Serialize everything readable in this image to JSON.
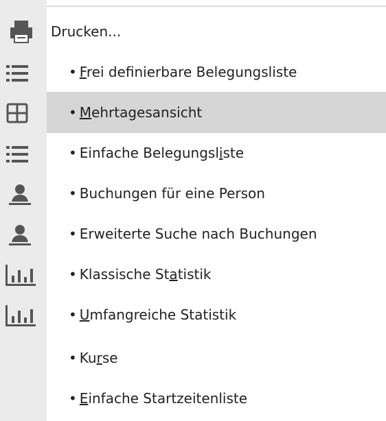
{
  "menu": {
    "items": [
      {
        "icon": "printer-icon",
        "prefix": "",
        "pre": "",
        "ul": "",
        "post": "Drucken...",
        "sub": false,
        "highlight": false
      },
      {
        "icon": "list-icon",
        "prefix": "•",
        "pre": "",
        "ul": "F",
        "post": "rei definierbare Belegungsliste",
        "sub": true,
        "highlight": false
      },
      {
        "icon": "grid-icon",
        "prefix": "•",
        "pre": "",
        "ul": "M",
        "post": "ehrtagesansicht",
        "sub": true,
        "highlight": true
      },
      {
        "icon": "list-icon",
        "prefix": "•",
        "pre": "Einfache Belegungsl",
        "ul": "i",
        "post": "ste",
        "sub": true,
        "highlight": false
      },
      {
        "icon": "person-icon",
        "prefix": "•",
        "pre": "Buchungen für eine Person",
        "ul": "",
        "post": "",
        "sub": true,
        "highlight": false
      },
      {
        "icon": "person-icon",
        "prefix": "•",
        "pre": "Erweiterte Suche nach Buchungen",
        "ul": "",
        "post": "",
        "sub": true,
        "highlight": false
      },
      {
        "icon": "bar-chart-icon",
        "prefix": "•",
        "pre": "Klassische St",
        "ul": "a",
        "post": "tistik",
        "sub": true,
        "highlight": false
      },
      {
        "icon": "bar-chart-icon",
        "prefix": "•",
        "pre": "",
        "ul": "U",
        "post": "mfangreiche Statistik",
        "sub": true,
        "highlight": false
      },
      {
        "icon": "",
        "prefix": "•",
        "pre": "Ku",
        "ul": "r",
        "post": "se",
        "sub": true,
        "highlight": false
      },
      {
        "icon": "",
        "prefix": "•",
        "pre": "",
        "ul": "E",
        "post": "infache Startzeitenliste",
        "sub": true,
        "highlight": false
      }
    ]
  },
  "colors": {
    "icon": "#555555",
    "highlight": "#d6d6d6",
    "gutter": "#ebebeb"
  }
}
